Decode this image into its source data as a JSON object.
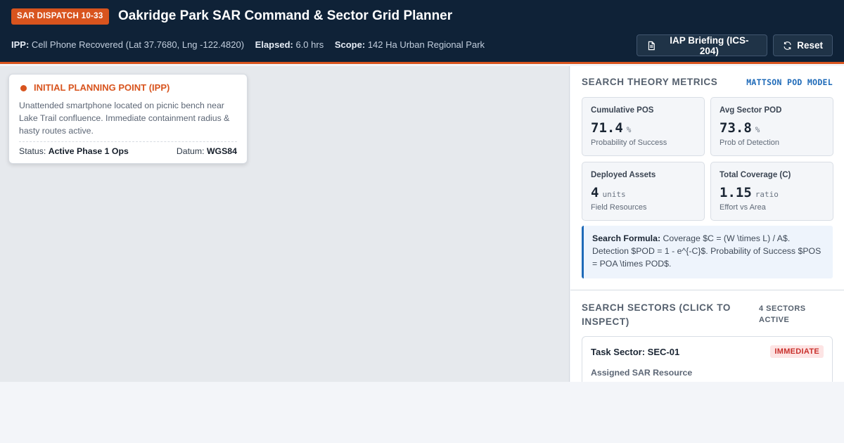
{
  "header": {
    "badge": "SAR DISPATCH 10-33",
    "title": "Oakridge Park SAR Command & Sector Grid Planner",
    "ipp_label": "IPP:",
    "ipp_value": "Cell Phone Recovered (Lat 37.7680, Lng -122.4820)",
    "elapsed_label": "Elapsed:",
    "elapsed_value": "6.0 hrs",
    "scope_label": "Scope:",
    "scope_value": "142 Ha Urban Regional Park",
    "iap_button": "IAP Briefing (ICS-204)",
    "reset_button": "Reset",
    "accent_color": "#d8541e"
  },
  "map": {
    "popup": {
      "title": "INITIAL PLANNING POINT (IPP)",
      "description": "Unattended smartphone located on picnic bench near Lake Trail confluence. Immediate containment radius & hasty routes active.",
      "status_label": "Status:",
      "status_value": "Active Phase 1 Ops",
      "datum_label": "Datum:",
      "datum_value": "WGS84"
    }
  },
  "metrics": {
    "title": "SEARCH THEORY METRICS",
    "model": "MATTSON POD MODEL",
    "cards": [
      {
        "label": "Cumulative POS",
        "value": "71.4",
        "unit": "%",
        "sub": "Probability of Success"
      },
      {
        "label": "Avg Sector POD",
        "value": "73.8",
        "unit": "%",
        "sub": "Prob of Detection"
      },
      {
        "label": "Deployed Assets",
        "value": "4",
        "unit": "units",
        "sub": "Field Resources"
      },
      {
        "label": "Total Coverage (C)",
        "value": "1.15",
        "unit": "ratio",
        "sub": "Effort vs Area"
      }
    ],
    "formula_label": "Search Formula:",
    "formula_text": "Coverage $C = (W \\times L) / A$. Detection $POD = 1 - e^{-C}$. Probability of Success $POS = POA \\times POD$."
  },
  "sectors": {
    "title": "SEARCH SECTORS (CLICK TO INSPECT)",
    "count": "4 SECTORS ACTIVE",
    "items": [
      {
        "name": "Task Sector: SEC-01",
        "priority": "IMMEDIATE",
        "resource_label": "Assigned SAR Resource"
      }
    ]
  }
}
